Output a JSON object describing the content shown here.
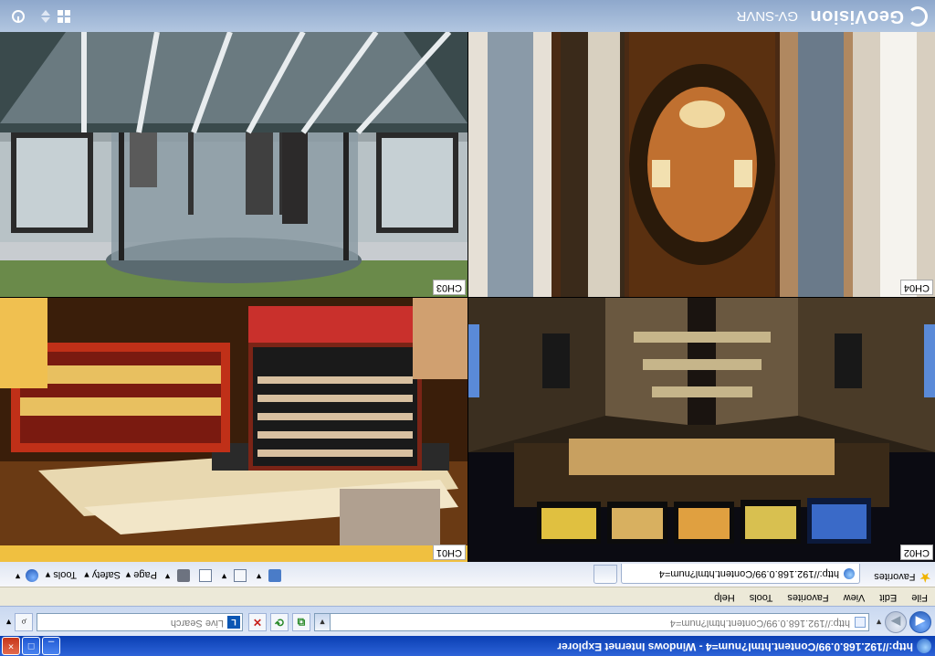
{
  "window": {
    "title": "http://192.168.0.99/Content.html?num=4 - Windows Internet Explorer",
    "buttons": [
      "_",
      "□",
      "×"
    ]
  },
  "address_bar": {
    "url": "http://192.168.0.99/Content.html?num=4",
    "search_placeholder": "Live Search"
  },
  "menu": [
    "File",
    "Edit",
    "View",
    "Favorites",
    "Tools",
    "Help"
  ],
  "command_bar": {
    "favorites": "Favorites",
    "tab_title": "http://192.168.0.99/Content.html?num=4",
    "commands": [
      "Page ▾",
      "Safety ▾",
      "Tools ▾"
    ]
  },
  "app": {
    "brand": "GeoVision",
    "product": "GV-SNVR"
  },
  "cameras": [
    {
      "label": "CH03",
      "scene": "revolving-door-entrance"
    },
    {
      "label": "CH04",
      "scene": "mall-atrium-escalators"
    },
    {
      "label": "CH01",
      "scene": "music-store-display"
    },
    {
      "label": "CH02",
      "scene": "station-escalators-monitors"
    }
  ],
  "colors": {
    "titlebar": "#0a3fb3",
    "gv_header": "#8ea8cc",
    "menubar": "#ece9d8"
  }
}
